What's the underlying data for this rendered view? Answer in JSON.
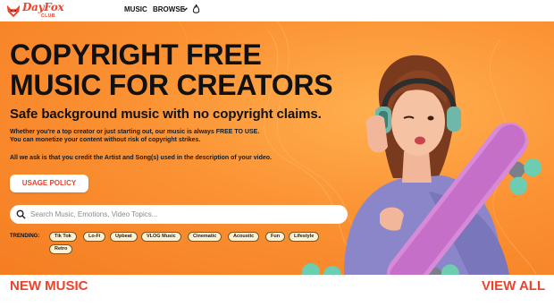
{
  "brand": {
    "name": "DayFox",
    "sub": "CLUB",
    "accent_color": "#e8442c",
    "hero_color": "#fb9233"
  },
  "nav": {
    "music": "MUSIC",
    "browse": "BROWSE",
    "browse_icon": "chevron-down-icon",
    "trending_icon": "flame-icon"
  },
  "hero": {
    "title": "COPYRIGHT FREE MUSIC FOR CREATORS",
    "subtitle": "Safe background music with no copyright claims.",
    "description_line1": "Whether you're a top creator or just starting out, our music is always FREE TO USE.",
    "description_line2": "You can monetize your content without risk of copyright strikes.",
    "description_line3": "All we ask is that you credit the Artist and Song(s) used in the description of your video.",
    "policy_button": "USAGE POLICY"
  },
  "search": {
    "placeholder": "Search Music, Emotions, Video Topics...",
    "value": ""
  },
  "trending": {
    "label": "TRENDING:",
    "tags": [
      "Tik Tok",
      "Lo-Fi",
      "Upbeat",
      "VLOG Music",
      "Cinematic",
      "Acoustic",
      "Fun",
      "Lifestyle",
      "Retro"
    ]
  },
  "section": {
    "title": "NEW MUSIC",
    "view_all": "VIEW ALL"
  }
}
